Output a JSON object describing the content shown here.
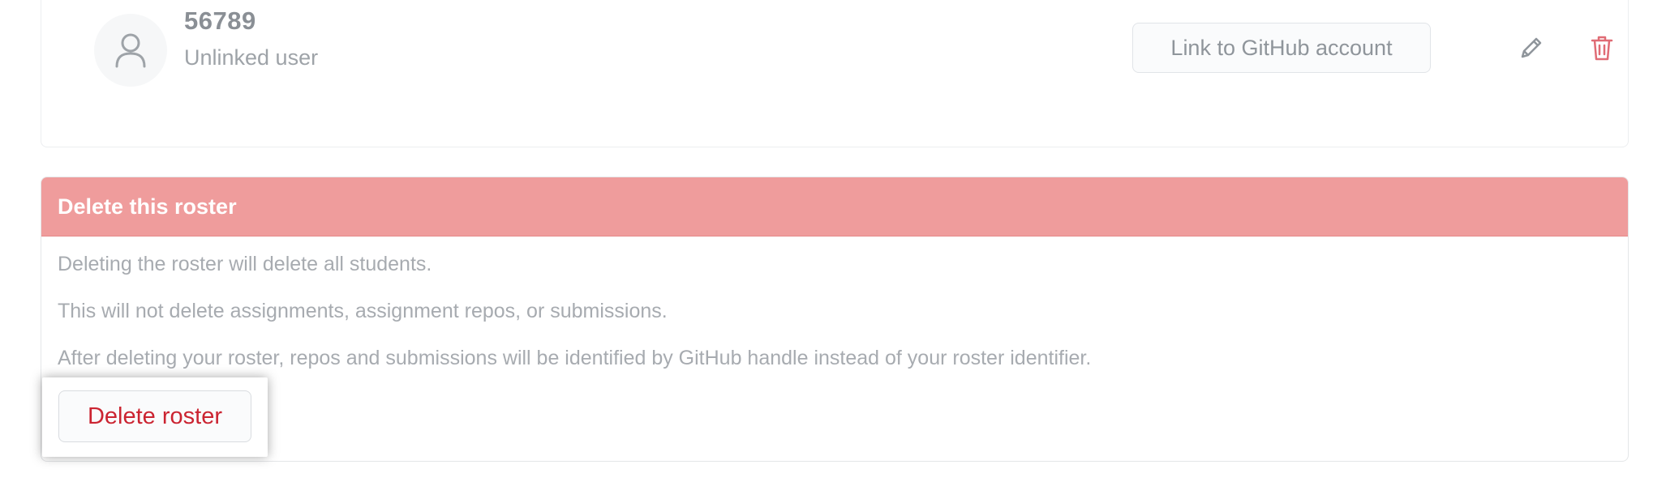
{
  "student": {
    "identifier": "56789",
    "status": "Unlinked user",
    "link_button_label": "Link to GitHub account",
    "edit_icon": "pencil-icon",
    "delete_icon": "trash-icon",
    "avatar_icon": "person-icon"
  },
  "danger_zone": {
    "title": "Delete this roster",
    "lines": [
      "Deleting the roster will delete all students.",
      "This will not delete assignments, assignment repos, or submissions.",
      "After deleting your roster, repos and submissions will be identified by GitHub handle instead of your roster identifier."
    ],
    "delete_button_label": "Delete roster"
  },
  "colors": {
    "danger_header_bg": "#ef9c9c",
    "danger_text": "#cb2431",
    "muted_text": "#a7abb0"
  }
}
